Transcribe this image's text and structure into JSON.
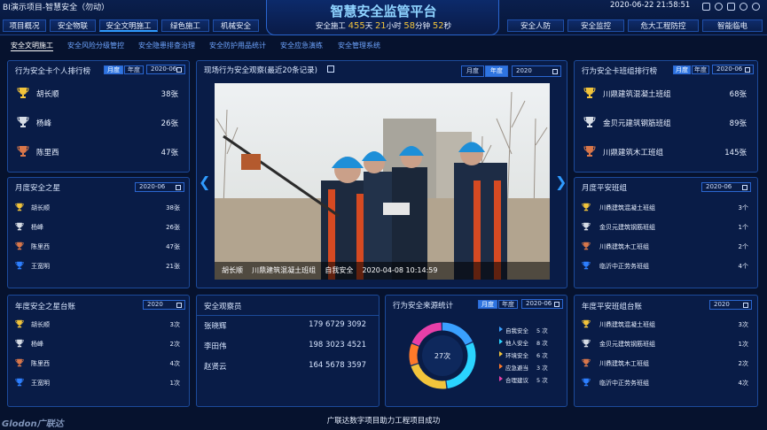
{
  "window": {
    "title": "BI演示项目-智慧安全（勿动）"
  },
  "nav_left": [
    "项目概况",
    "安全物联",
    "安全文明施工",
    "绿色施工",
    "机械安全"
  ],
  "nav_right": [
    "安全人防",
    "安全监控",
    "危大工程防控",
    "智能临电"
  ],
  "header": {
    "title": "智慧安全监管平台",
    "safe_prefix": "安全施工",
    "days": "455",
    "days_unit": "天",
    "hours": "21",
    "hours_unit": "小时",
    "minutes": "58",
    "minutes_unit": "分钟",
    "seconds": "52",
    "seconds_unit": "秒",
    "datetime": "2020-06-22 21:58:51"
  },
  "subtabs": [
    "安全文明施工",
    "安全风险分级管控",
    "安全隐患排查治理",
    "安全防护用品统计",
    "安全应急演练",
    "安全管理系统"
  ],
  "personal_rank": {
    "title": "行为安全卡个人排行榜",
    "seg_month": "月度",
    "seg_year": "年度",
    "date": "2020-06",
    "rows": [
      {
        "name": "胡长顺",
        "value": "38张",
        "medal": "gold"
      },
      {
        "name": "杨峰",
        "value": "26张",
        "medal": "silver"
      },
      {
        "name": "陈里西",
        "value": "47张",
        "medal": "bronze"
      }
    ]
  },
  "monthly_star": {
    "title": "月度安全之星",
    "date": "2020-06",
    "rows": [
      {
        "name": "胡长顺",
        "value": "38张",
        "medal": "gold"
      },
      {
        "name": "杨峰",
        "value": "26张",
        "medal": "silver"
      },
      {
        "name": "陈里西",
        "value": "47张",
        "medal": "bronze"
      },
      {
        "name": "王宽明",
        "value": "21张",
        "medal": "blue"
      }
    ]
  },
  "yearly_star": {
    "title": "年度安全之星台账",
    "date": "2020",
    "rows": [
      {
        "name": "胡长顺",
        "value": "3次",
        "medal": "gold"
      },
      {
        "name": "杨峰",
        "value": "2次",
        "medal": "silver"
      },
      {
        "name": "陈里西",
        "value": "4次",
        "medal": "bronze"
      },
      {
        "name": "王宽明",
        "value": "1次",
        "medal": "blue"
      }
    ]
  },
  "observation": {
    "title": "现场行为安全观察(最近20条记录)",
    "seg_month": "月度",
    "seg_year": "年度",
    "date": "2020",
    "caption": "胡长顺    川鼎建筑混凝土班组    自我安全    2020-04-08 10:14:59"
  },
  "observers": {
    "title": "安全观察员",
    "rows": [
      {
        "name": "张晓辉",
        "phone": "179 6729 3092"
      },
      {
        "name": "李田伟",
        "phone": "198 3023 4521"
      },
      {
        "name": "赵贤云",
        "phone": "164 5678 3597"
      }
    ]
  },
  "source_stats": {
    "title": "行为安全来源统计",
    "seg_month": "月度",
    "seg_year": "年度",
    "date": "2020-06",
    "center_label": "27次",
    "legend": [
      {
        "label": "自我安全",
        "value": "5 次",
        "color": "#3aa0ff"
      },
      {
        "label": "他人安全",
        "value": "8 次",
        "color": "#2ad4ff"
      },
      {
        "label": "环境安全",
        "value": "6 次",
        "color": "#f2c43b"
      },
      {
        "label": "应急避当",
        "value": "3 次",
        "color": "#ff7a2a"
      },
      {
        "label": "合理建议",
        "value": "5 次",
        "color": "#e83fa8"
      }
    ]
  },
  "team_rank": {
    "title": "行为安全卡班组排行榜",
    "seg_month": "月度",
    "seg_year": "年度",
    "date": "2020-06",
    "rows": [
      {
        "name": "川鼎建筑混凝土班组",
        "value": "68张",
        "medal": "gold"
      },
      {
        "name": "金贝元建筑钢筋班组",
        "value": "89张",
        "medal": "silver"
      },
      {
        "name": "川鼎建筑木工班组",
        "value": "145张",
        "medal": "bronze"
      }
    ]
  },
  "monthly_team": {
    "title": "月度平安班组",
    "date": "2020-06",
    "rows": [
      {
        "name": "川鼎建筑混凝土班组",
        "value": "3个",
        "medal": "gold"
      },
      {
        "name": "金贝元建筑钢筋班组",
        "value": "1个",
        "medal": "silver"
      },
      {
        "name": "川鼎建筑木工班组",
        "value": "2个",
        "medal": "bronze"
      },
      {
        "name": "临沂中正劳务班组",
        "value": "4个",
        "medal": "blue"
      }
    ]
  },
  "yearly_team": {
    "title": "年度平安班组台账",
    "date": "2020",
    "rows": [
      {
        "name": "川鼎建筑混凝土班组",
        "value": "3次",
        "medal": "gold"
      },
      {
        "name": "金贝元建筑钢筋班组",
        "value": "1次",
        "medal": "silver"
      },
      {
        "name": "川鼎建筑木工班组",
        "value": "2次",
        "medal": "bronze"
      },
      {
        "name": "临沂中正劳务班组",
        "value": "4次",
        "medal": "blue"
      }
    ]
  },
  "footer": {
    "text": "广联达数字项目助力工程项目成功",
    "logo": "Glodon广联达"
  },
  "colors": {
    "gold": "#f2c43b",
    "silver": "#d7dde6",
    "bronze": "#d9774a",
    "blue": "#2d7fff",
    "accent": "#2f9bff"
  }
}
